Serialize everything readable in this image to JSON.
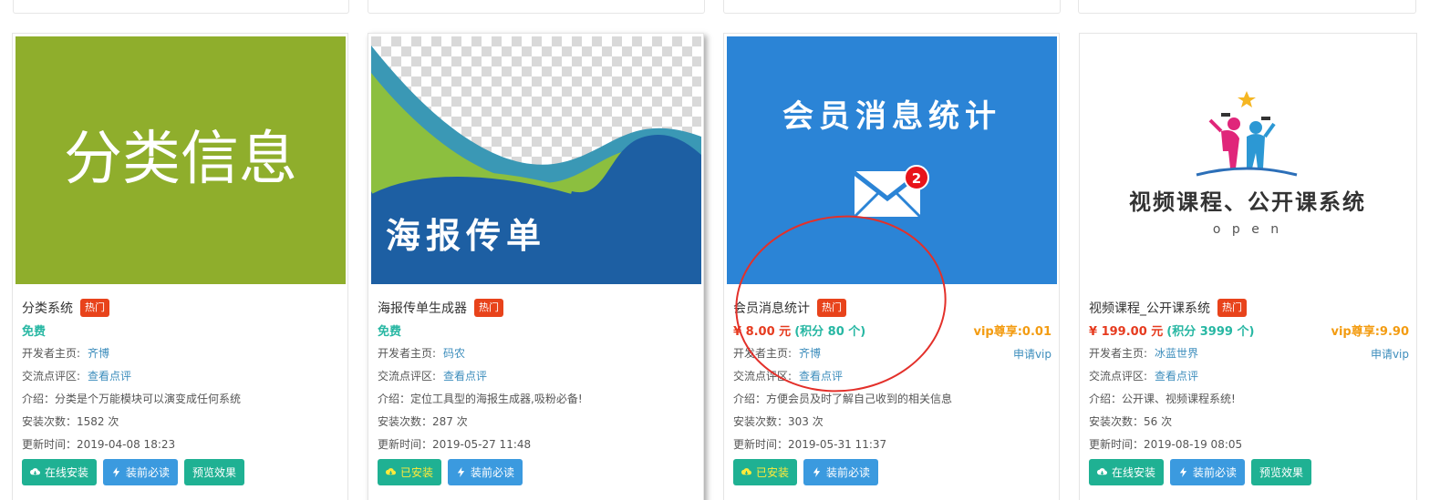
{
  "cards": [
    {
      "title": "分类系统",
      "hot": "热门",
      "price_free": "免费",
      "developer_label": "开发者主页:",
      "developer": "齐博",
      "comments_label": "交流点评区:",
      "comments_link": "查看点评",
      "intro": "介绍：分类是个万能模块可以演变成任何系统",
      "installs": "安装次数：1582 次",
      "updated": "更新时间：2019-04-08 18:23",
      "buttons": [
        "在线安装",
        "装前必读",
        "预览效果"
      ],
      "thumb_text": "分类信息",
      "thumb_color": "#8fae2c"
    },
    {
      "title": "海报传单生成器",
      "hot": "热门",
      "price_free": "免费",
      "developer_label": "开发者主页:",
      "developer": "码农",
      "comments_label": "交流点评区:",
      "comments_link": "查看点评",
      "intro": "介绍：定位工具型的海报生成器,吸粉必备!",
      "installs": "安装次数：287 次",
      "updated": "更新时间：2019-05-27 11:48",
      "buttons": [
        "已安装",
        "装前必读"
      ],
      "thumb_text": "海报传单"
    },
    {
      "title": "会员消息统计",
      "hot": "热门",
      "price": "¥ 8.00 元",
      "points": "(积分 80 个)",
      "vip_price": "vip尊享:0.01",
      "apply_vip": "申请vip",
      "developer_label": "开发者主页:",
      "developer": "齐博",
      "comments_label": "交流点评区:",
      "comments_link": "查看点评",
      "intro": "介绍：方便会员及时了解自己收到的相关信息",
      "installs": "安装次数：303 次",
      "updated": "更新时间：2019-05-31 11:37",
      "buttons": [
        "已安装",
        "装前必读"
      ],
      "thumb_text": "会员消息统计",
      "badge_count": "2",
      "thumb_color": "#2b84d6"
    },
    {
      "title": "视频课程_公开课系统",
      "hot": "热门",
      "price": "¥ 199.00 元",
      "points": "(积分 3999 个)",
      "vip_price": "vip尊享:9.90",
      "apply_vip": "申请vip",
      "developer_label": "开发者主页:",
      "developer": "冰蓝世界",
      "comments_label": "交流点评区:",
      "comments_link": "查看点评",
      "intro": "介绍：公开课、视频课程系统!",
      "installs": "安装次数：56 次",
      "updated": "更新时间：2019-08-19 08:05",
      "buttons": [
        "在线安装",
        "装前必读",
        "预览效果"
      ],
      "thumb_text": "视频课程、公开课系统",
      "thumb_sub": "o p e n"
    }
  ],
  "colors": {
    "hot": "#e8431b",
    "green": "#1fb193",
    "blue": "#3b9adf",
    "link": "#3c8dbc",
    "vip": "#f39c12"
  },
  "icons": {
    "install": "cloud-download-icon",
    "read": "bolt-icon"
  }
}
